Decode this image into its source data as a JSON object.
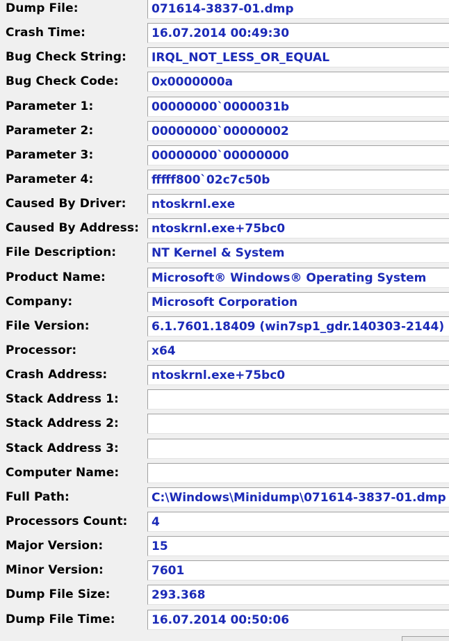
{
  "properties": [
    {
      "label": "Dump File:",
      "value": "071614-3837-01.dmp"
    },
    {
      "label": "Crash Time:",
      "value": "16.07.2014 00:49:30"
    },
    {
      "label": "Bug Check String:",
      "value": "IRQL_NOT_LESS_OR_EQUAL"
    },
    {
      "label": "Bug Check Code:",
      "value": "0x0000000a"
    },
    {
      "label": "Parameter 1:",
      "value": "00000000`0000031b"
    },
    {
      "label": "Parameter 2:",
      "value": "00000000`00000002"
    },
    {
      "label": "Parameter 3:",
      "value": "00000000`00000000"
    },
    {
      "label": "Parameter 4:",
      "value": "fffff800`02c7c50b"
    },
    {
      "label": "Caused By Driver:",
      "value": "ntoskrnl.exe"
    },
    {
      "label": "Caused By Address:",
      "value": "ntoskrnl.exe+75bc0"
    },
    {
      "label": "File Description:",
      "value": "NT Kernel & System"
    },
    {
      "label": "Product Name:",
      "value": "Microsoft® Windows® Operating System"
    },
    {
      "label": "Company:",
      "value": "Microsoft Corporation"
    },
    {
      "label": "File Version:",
      "value": "6.1.7601.18409 (win7sp1_gdr.140303-2144)"
    },
    {
      "label": "Processor:",
      "value": "x64"
    },
    {
      "label": "Crash Address:",
      "value": "ntoskrnl.exe+75bc0"
    },
    {
      "label": "Stack Address 1:",
      "value": ""
    },
    {
      "label": "Stack Address 2:",
      "value": ""
    },
    {
      "label": "Stack Address 3:",
      "value": ""
    },
    {
      "label": "Computer Name:",
      "value": ""
    },
    {
      "label": "Full Path:",
      "value": "C:\\Windows\\Minidump\\071614-3837-01.dmp"
    },
    {
      "label": "Processors Count:",
      "value": "4"
    },
    {
      "label": "Major Version:",
      "value": "15"
    },
    {
      "label": "Minor Version:",
      "value": "7601"
    },
    {
      "label": "Dump File Size:",
      "value": "293.368"
    },
    {
      "label": "Dump File Time:",
      "value": "16.07.2014 00:50:06"
    }
  ],
  "colors": {
    "background": "#f0f0f0",
    "label_text": "#000000",
    "value_text": "#1b2ab7",
    "field_background": "#ffffff"
  }
}
